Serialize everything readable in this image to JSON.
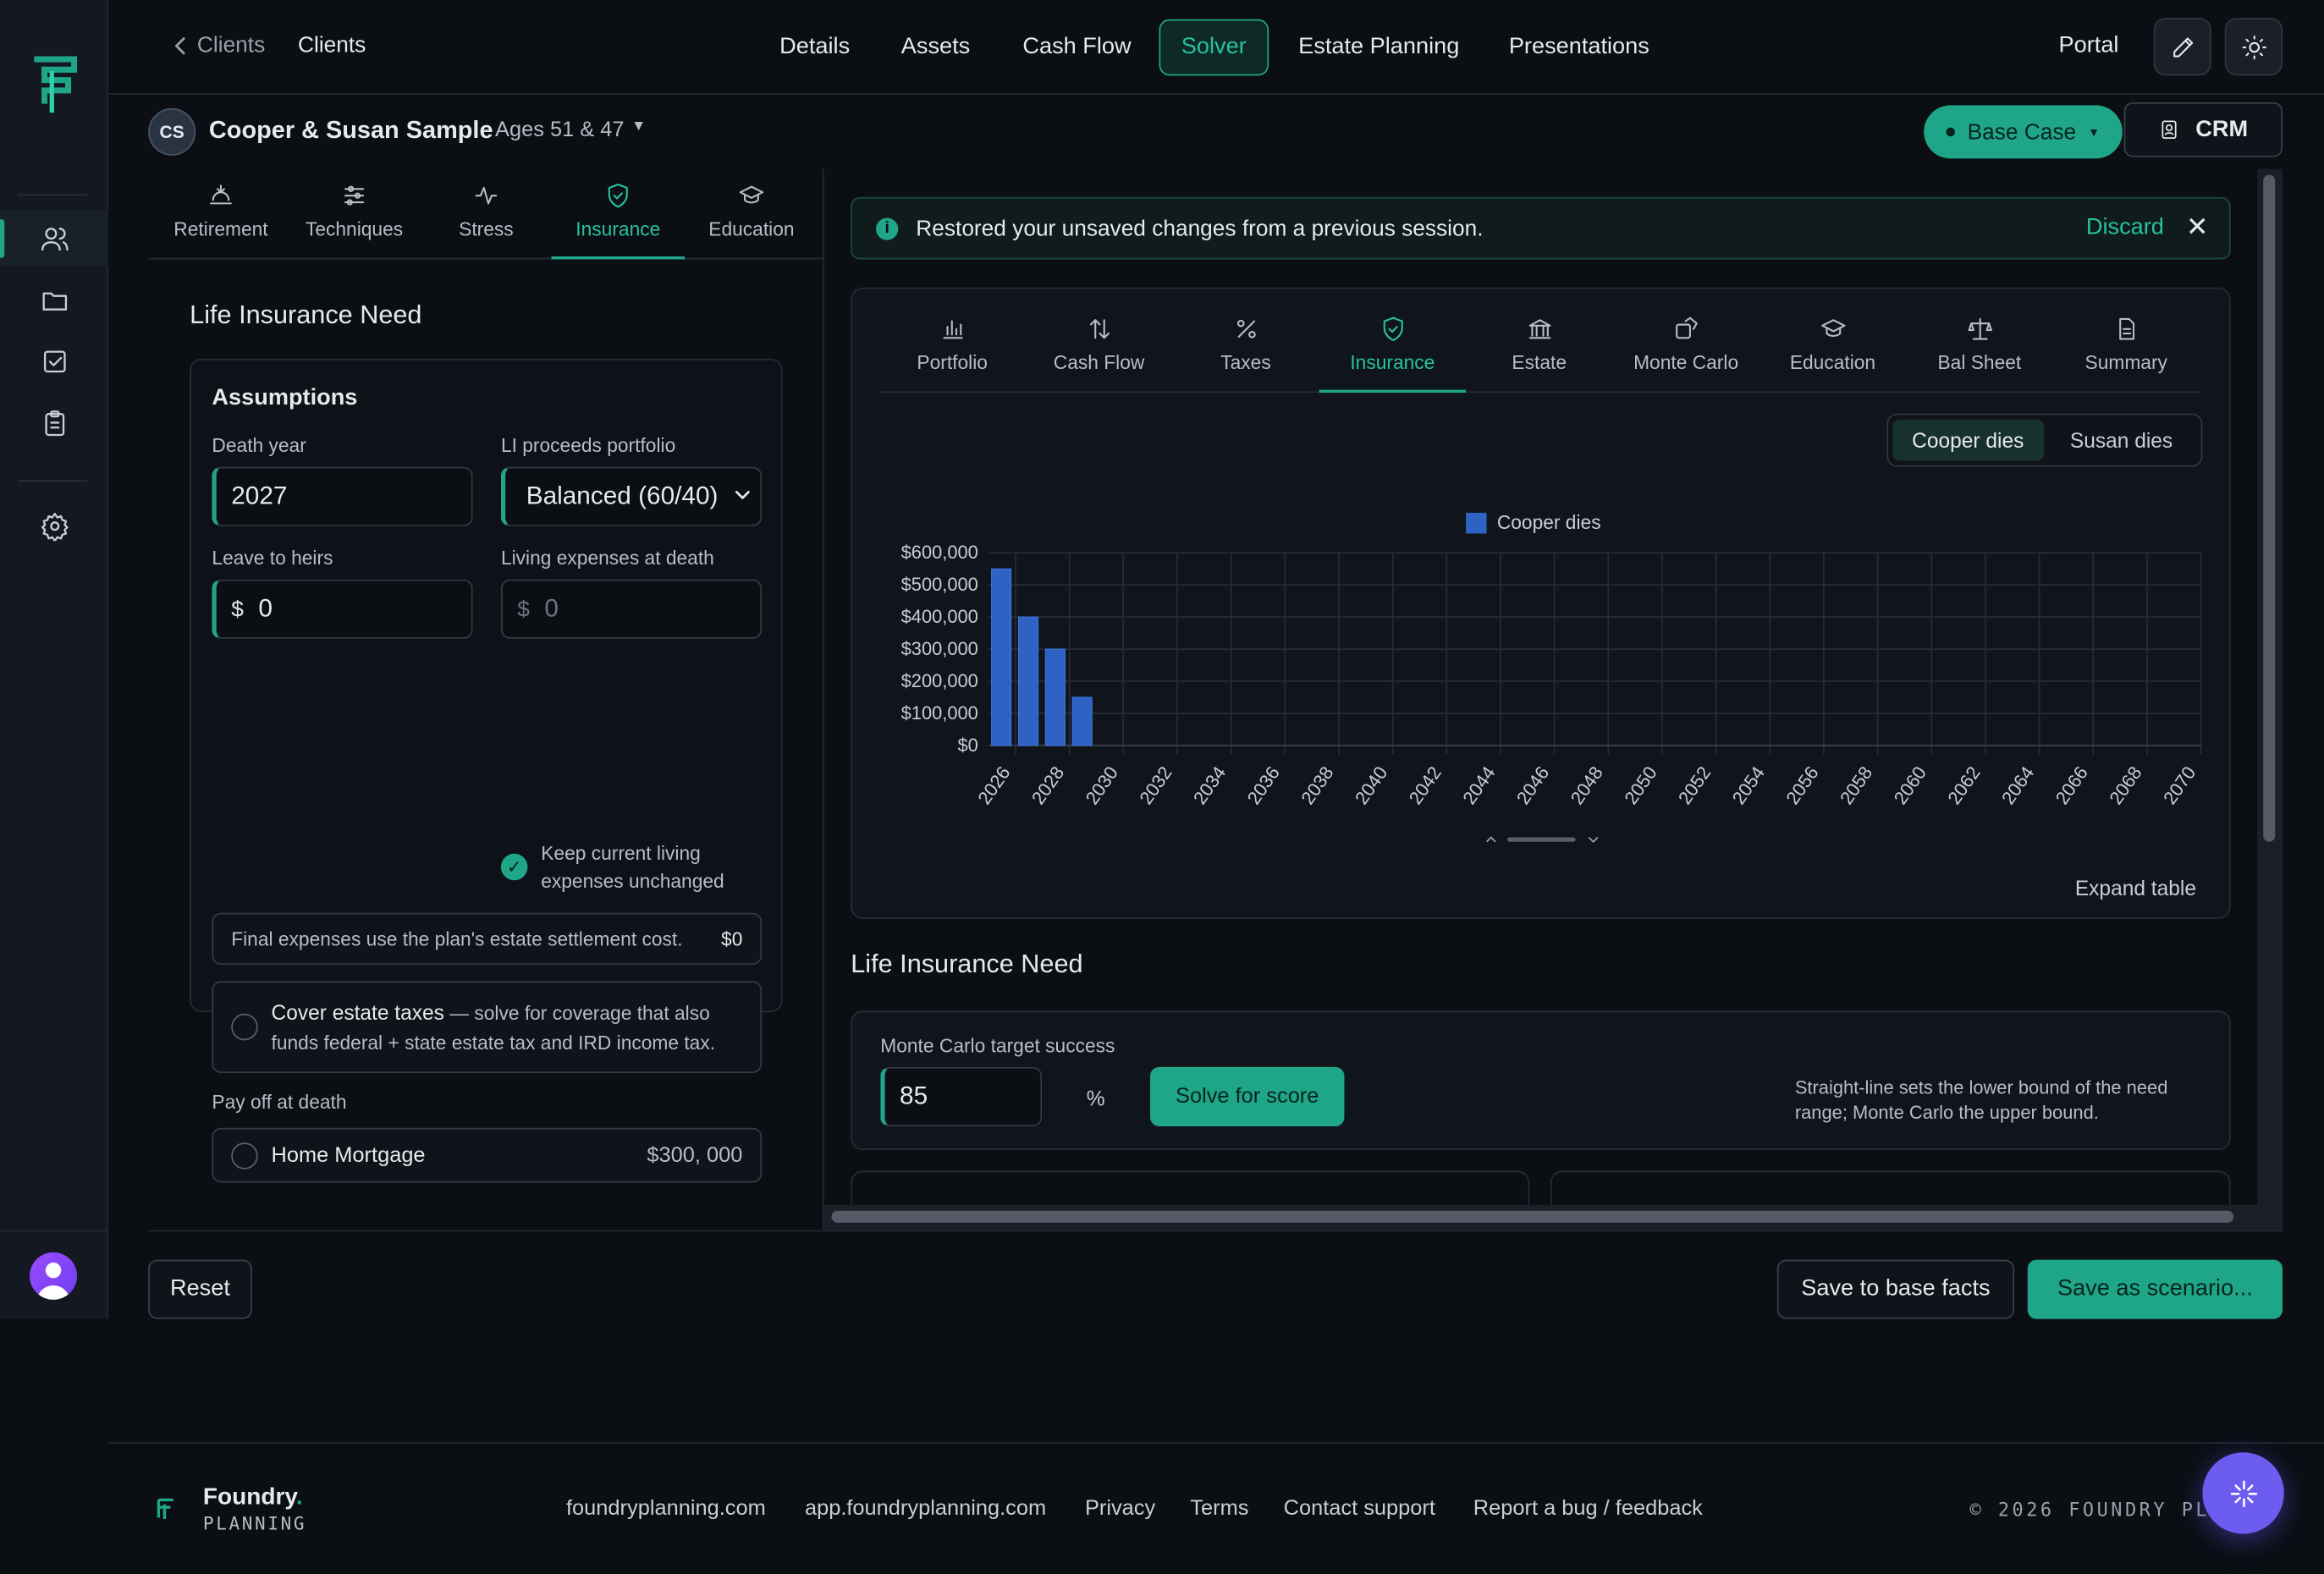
{
  "breadcrumb": {
    "parent": "Clients",
    "current": "Clients"
  },
  "topnav": {
    "items": [
      "Details",
      "Assets",
      "Cash Flow",
      "Solver",
      "Estate Planning",
      "Presentations"
    ],
    "active": "Solver",
    "portal": "Portal"
  },
  "client": {
    "initials": "CS",
    "name": "Cooper & Susan Sample",
    "ages": "· Ages 51 & 47",
    "scenario": "Base Case",
    "crm": "CRM"
  },
  "solver_tabs": {
    "items": [
      "Retirement",
      "Techniques",
      "Stress",
      "Insurance",
      "Education"
    ],
    "active": "Insurance"
  },
  "left": {
    "title": "Life Insurance Need",
    "assumptions_title": "Assumptions",
    "death_year_label": "Death year",
    "death_year": "2027",
    "portfolio_label": "LI proceeds portfolio",
    "portfolio": "Balanced (60/40)",
    "heirs_label": "Leave to heirs",
    "heirs_value": "0",
    "living_label": "Living expenses at death",
    "living_value": "0",
    "currency": "$",
    "keep_living": "Keep current living expenses unchanged",
    "final_expenses": "Final expenses use the plan's estate settlement cost.",
    "final_value": "$0",
    "cover_title": "Cover estate taxes",
    "cover_text": " — solve for coverage that also funds federal + state estate tax and IRD income tax.",
    "payoff_label": "Pay off at death",
    "mortgage_label": "Home Mortgage",
    "mortgage_value": "$300, 000"
  },
  "banner": {
    "text": "Restored your unsaved changes from a previous session.",
    "discard": "Discard",
    "close": "✕"
  },
  "report_tabs": {
    "items": [
      "Portfolio",
      "Cash Flow",
      "Taxes",
      "Insurance",
      "Estate",
      "Monte Carlo",
      "Education",
      "Bal Sheet",
      "Summary"
    ],
    "active": "Insurance"
  },
  "scenario_toggle": {
    "options": [
      "Cooper dies",
      "Susan dies"
    ],
    "active": "Cooper dies"
  },
  "chart_data": {
    "type": "bar",
    "title": "",
    "xlabel": "",
    "ylabel": "",
    "series": [
      {
        "name": "Cooper dies",
        "color": "#2e63c4",
        "values": [
          550000,
          400000,
          300000,
          150000
        ]
      }
    ],
    "x": [
      2026,
      2027,
      2028,
      2029
    ],
    "x_range": [
      2026,
      2071
    ],
    "x_tick_labels": [
      "2026",
      "2028",
      "2030",
      "2032",
      "2034",
      "2036",
      "2038",
      "2040",
      "2042",
      "2044",
      "2046",
      "2048",
      "2050",
      "2052",
      "2054",
      "2056",
      "2058",
      "2060",
      "2062",
      "2064",
      "2066",
      "2068",
      "2070"
    ],
    "ylim": [
      0,
      600000
    ],
    "y_tick_labels": [
      "$600,000",
      "$500,000",
      "$400,000",
      "$300,000",
      "$200,000",
      "$100,000",
      "$0"
    ],
    "grid": true,
    "legend": "top-center"
  },
  "expand_table": "Expand table",
  "need": {
    "title": "Life Insurance Need",
    "mc_label": "Monte Carlo target success",
    "mc_value": "85",
    "mc_unit": "%",
    "solve_button": "Solve for score",
    "note": "Straight-line sets the lower bound of the need range; Monte Carlo the upper bound."
  },
  "actions": {
    "reset": "Reset",
    "save_base": "Save to base facts",
    "save_scenario": "Save as scenario..."
  },
  "footer": {
    "brand": "Foundry",
    "brand_dot": ".",
    "sub": "PLANNING",
    "links": [
      "foundryplanning.com",
      "app.foundryplanning.com",
      "Privacy",
      "Terms",
      "Contact support",
      "Report a bug / feedback"
    ],
    "copyright": "© 2026 FOUNDRY PL"
  },
  "colors": {
    "accent": "#1fa588",
    "bar": "#2e63c4",
    "background": "#0b0e13"
  }
}
